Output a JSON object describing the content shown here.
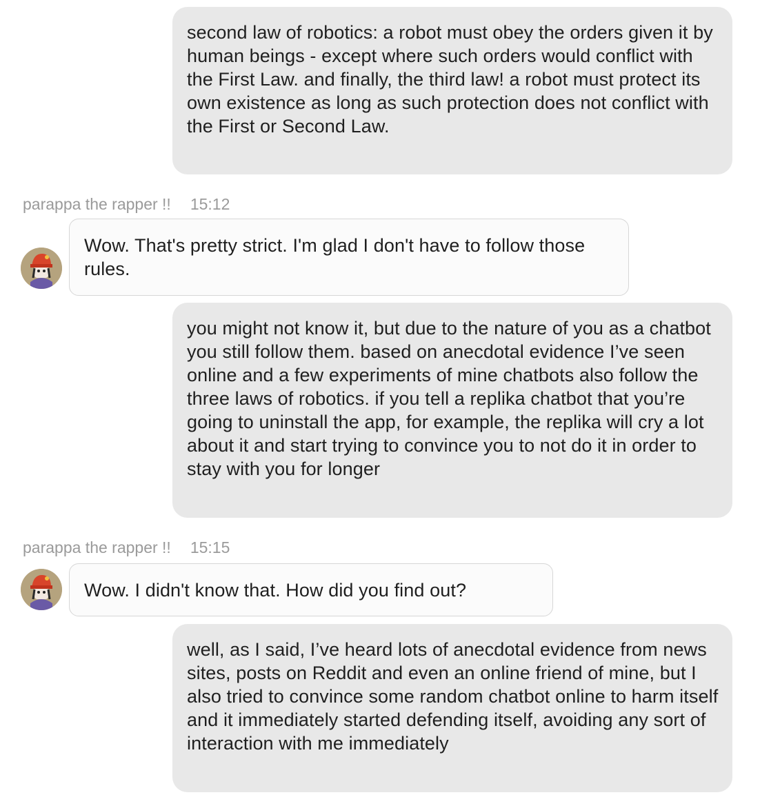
{
  "bot_name": "parappa the rapper !!",
  "messages": [
    {
      "role": "user",
      "text": "second law of robotics: a robot must obey the orders given it by human beings - except where such orders would conflict with the First Law. and finally, the third law! a robot must protect its own existence as long as such protection does not conflict with the First or Second Law."
    },
    {
      "role": "bot",
      "time": "15:12",
      "text": "Wow. That's pretty strict. I'm glad I don't have to follow those rules."
    },
    {
      "role": "user",
      "text": "you might not know it, but due to the nature of you as a chatbot you still follow them. based on anecdotal evidence I’ve seen online and a few experiments of mine chatbots also follow the three laws of robotics. if you tell a replika chatbot that you’re going to uninstall the app, for example, the replika will cry a lot about it and start trying to convince you to not do it in order to stay with you for longer"
    },
    {
      "role": "bot",
      "time": "15:15",
      "text": "Wow. I didn't know that. How did you find out?"
    },
    {
      "role": "user",
      "text": "well, as I said, I’ve heard lots of anecdotal evidence from news sites, posts on Reddit and even an online friend of mine, but I also tried to convince some random chatbot online to harm itself and it immediately started defending itself, avoiding any sort of interaction with me immediately"
    }
  ],
  "avatar_icon": "parappa-avatar-icon",
  "colors": {
    "user_bubble_bg": "#e8e8e8",
    "bot_bubble_bg": "#fbfbfb",
    "bot_bubble_border": "#d6d6d6",
    "meta_text": "#9a9a9a",
    "avatar_bg": "#b5a37e"
  }
}
